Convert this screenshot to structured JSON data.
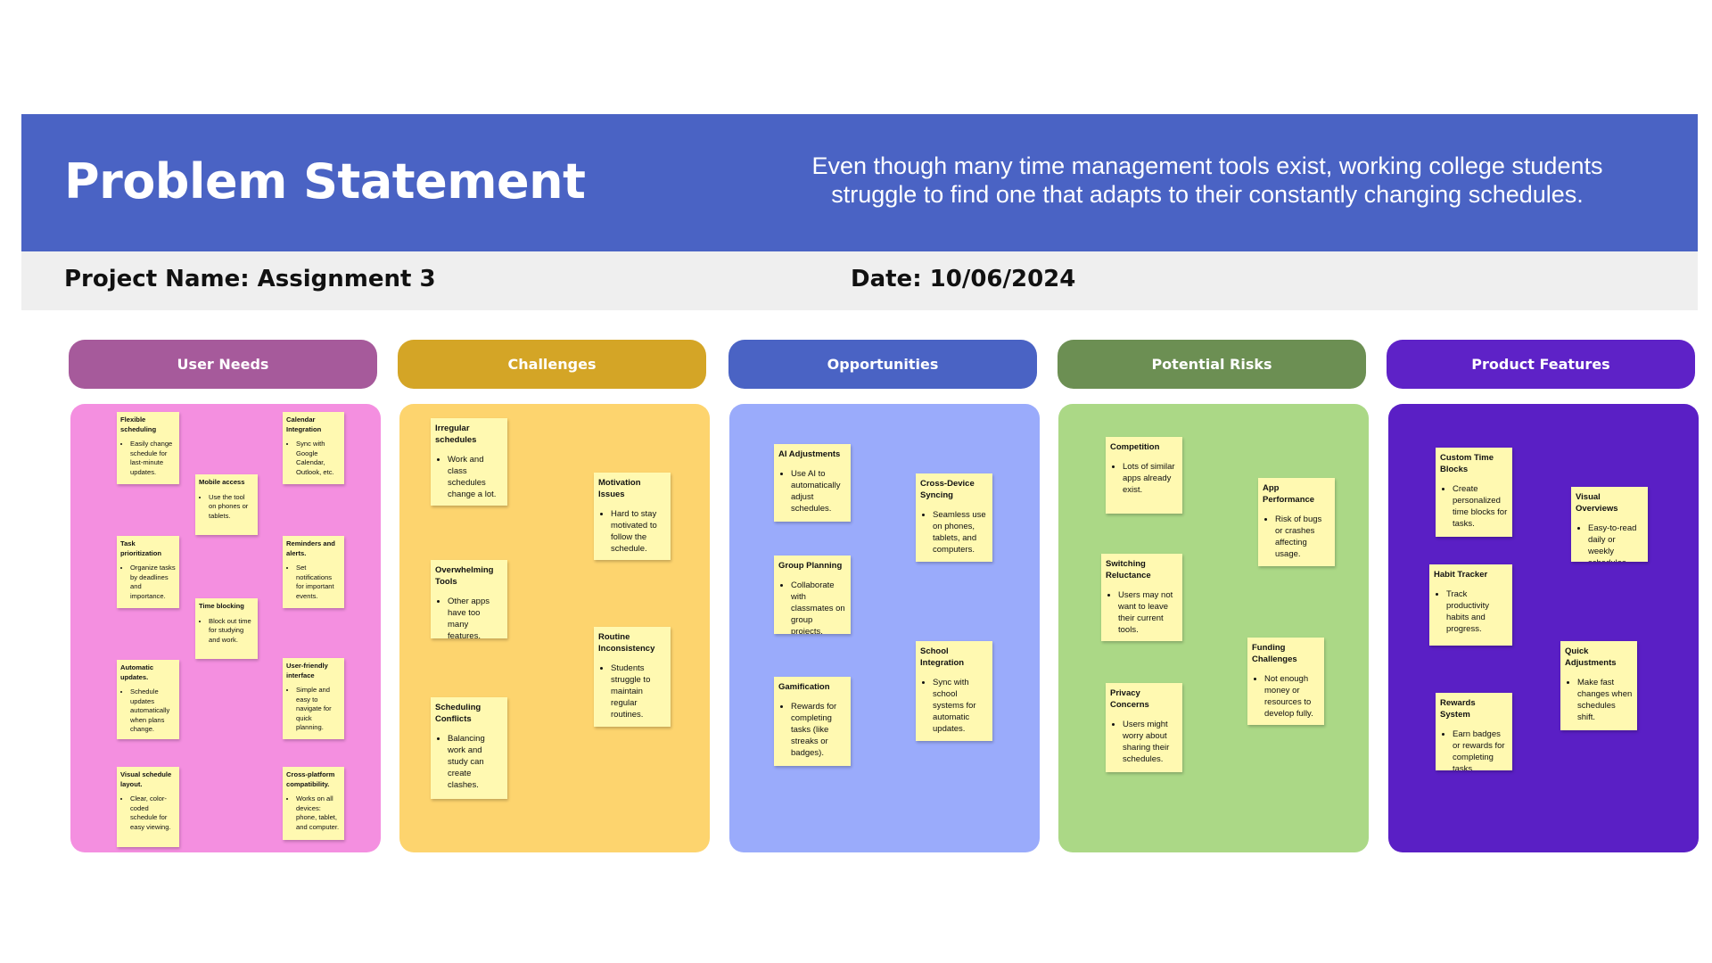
{
  "header": {
    "title": "Problem Statement",
    "statement": "Even though many time management tools exist, working college students struggle to find one that adapts to their constantly changing schedules."
  },
  "info": {
    "project": "Project Name: Assignment 3",
    "date": "Date: 10/06/2024"
  },
  "colors": {
    "header_bg": "#4a63c4",
    "user_needs_head": "#a65a9b",
    "user_needs_panel": "#f48fe0",
    "challenges_head": "#d4a526",
    "challenges_panel": "#fdd46e",
    "opportunities_head": "#4a63c4",
    "opportunities_panel": "#9aabfb",
    "risks_head": "#6c8f53",
    "risks_panel": "#abd886",
    "features_head": "#5e22c7",
    "features_panel": "#5a1fc5",
    "sticky_note": "#fff9b1"
  },
  "columns": [
    {
      "label": "User Needs",
      "notes": [
        {
          "title": "Flexible scheduling",
          "bullet": "Easily change schedule for last-minute updates."
        },
        {
          "title": "Calendar Integration",
          "bullet": "Sync with Google Calendar, Outlook, etc."
        },
        {
          "title": "Mobile access",
          "bullet": "Use the tool on phones or tablets."
        },
        {
          "title": "Task prioritization",
          "bullet": "Organize tasks by deadlines and importance."
        },
        {
          "title": "Reminders and alerts.",
          "bullet": "Set notifications for important events."
        },
        {
          "title": "Time blocking",
          "bullet": "Block out time for studying and work."
        },
        {
          "title": "Automatic updates.",
          "bullet": "Schedule updates automatically when plans change."
        },
        {
          "title": "User-friendly interface",
          "bullet": "Simple and easy to navigate for quick planning."
        },
        {
          "title": "Visual schedule layout.",
          "bullet": "Clear, color-coded schedule for easy viewing."
        },
        {
          "title": "Cross-platform compatibility.",
          "bullet": "Works on all devices: phone, tablet, and computer."
        }
      ]
    },
    {
      "label": "Challenges",
      "notes": [
        {
          "title": "Irregular schedules",
          "bullet": "Work and class schedules change a lot."
        },
        {
          "title": "Motivation Issues",
          "bullet": "Hard to stay motivated to follow the schedule."
        },
        {
          "title": "Overwhelming Tools",
          "bullet": "Other apps have too many features."
        },
        {
          "title": "Routine Inconsistency",
          "bullet": "Students struggle to maintain regular routines."
        },
        {
          "title": "Scheduling Conflicts",
          "bullet": "Balancing work and study can create clashes."
        }
      ]
    },
    {
      "label": "Opportunities",
      "notes": [
        {
          "title": "AI Adjustments",
          "bullet": "Use AI to automatically adjust schedules."
        },
        {
          "title": "Cross-Device Syncing",
          "bullet": "Seamless use on phones, tablets, and computers."
        },
        {
          "title": "Group Planning",
          "bullet": "Collaborate with classmates on group projects."
        },
        {
          "title": "School Integration",
          "bullet": "Sync with school systems for automatic updates."
        },
        {
          "title": "Gamification",
          "bullet": "Rewards for completing tasks (like streaks or badges)."
        }
      ]
    },
    {
      "label": "Potential Risks",
      "notes": [
        {
          "title": "Competition",
          "bullet": "Lots of similar apps already exist."
        },
        {
          "title": "App Performance",
          "bullet": "Risk of bugs or crashes affecting usage."
        },
        {
          "title": "Switching Reluctance",
          "bullet": "Users may not want to leave their current tools."
        },
        {
          "title": "Funding Challenges",
          "bullet": "Not enough money or resources to develop fully."
        },
        {
          "title": "Privacy Concerns",
          "bullet": "Users might worry about sharing their schedules."
        }
      ]
    },
    {
      "label": "Product Features",
      "notes": [
        {
          "title": "Custom Time Blocks",
          "bullet": "Create personalized time blocks for tasks."
        },
        {
          "title": "Visual Overviews",
          "bullet": "Easy-to-read daily or weekly schedules."
        },
        {
          "title": "Habit Tracker",
          "bullet": "Track productivity habits and progress."
        },
        {
          "title": "Quick Adjustments",
          "bullet": "Make fast changes when schedules shift."
        },
        {
          "title": "Rewards System",
          "bullet": "Earn badges or rewards for completing tasks."
        }
      ]
    }
  ]
}
